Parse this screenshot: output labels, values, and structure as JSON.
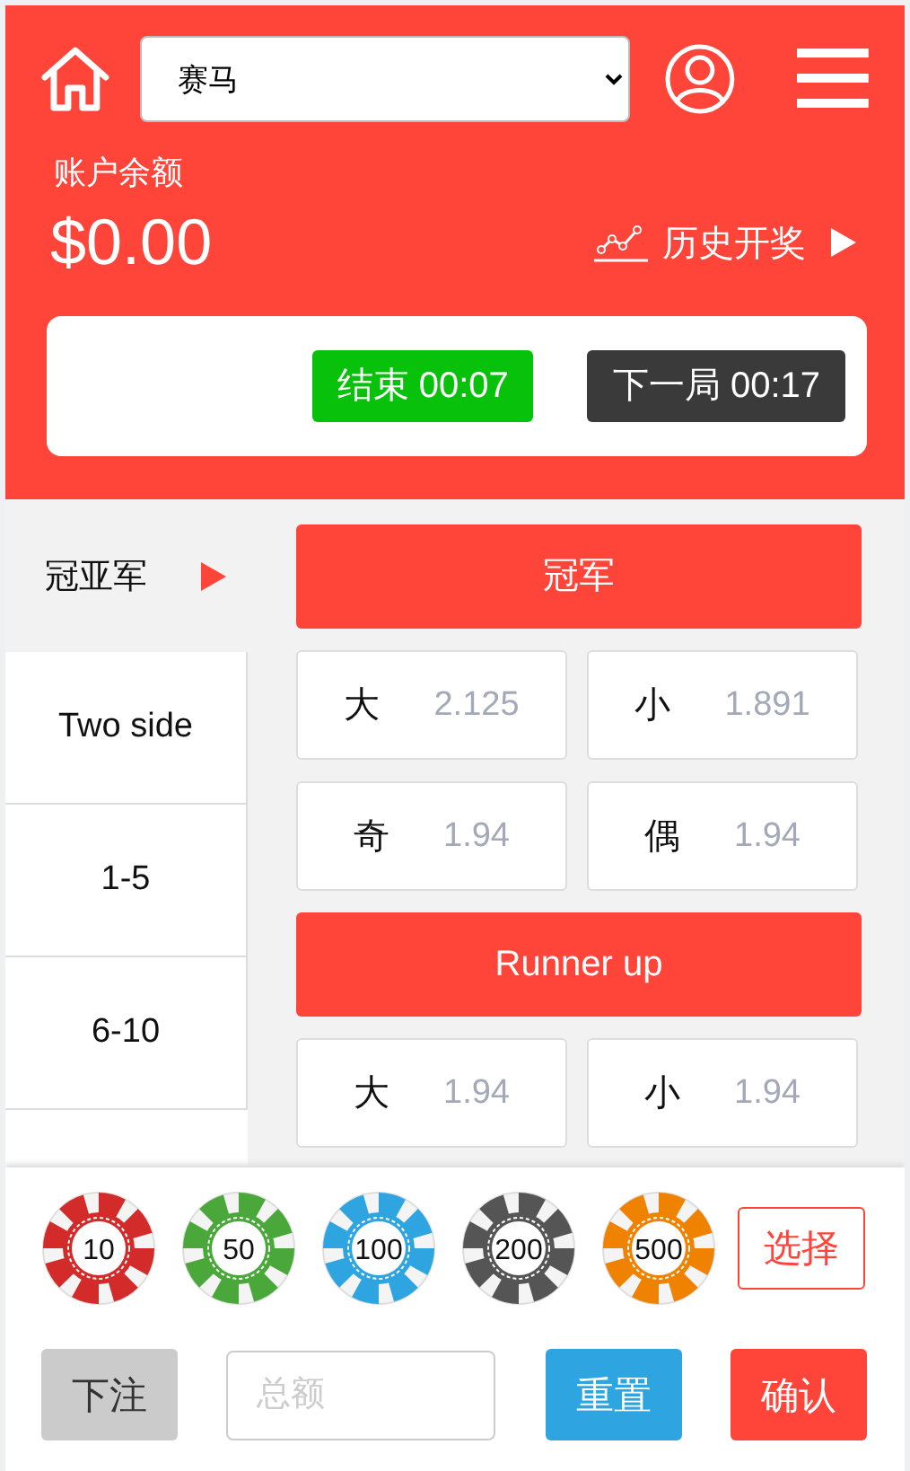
{
  "header": {
    "game_select": {
      "value": "赛马"
    }
  },
  "balance": {
    "label": "账户余额",
    "amount": "$0.00"
  },
  "history_link": {
    "label": "历史开奖"
  },
  "timers": {
    "closing": "结束 00:07",
    "next": "下一局 00:17"
  },
  "sidebar": {
    "items": [
      {
        "label": "冠亚军",
        "selected": true
      },
      {
        "label": "Two side",
        "selected": false
      },
      {
        "label": "1-5",
        "selected": false
      },
      {
        "label": "6-10",
        "selected": false
      }
    ]
  },
  "bet_groups": [
    {
      "title": "冠军",
      "bets": [
        {
          "label": "大",
          "odds": "2.125"
        },
        {
          "label": "小",
          "odds": "1.891"
        },
        {
          "label": "奇",
          "odds": "1.94"
        },
        {
          "label": "偶",
          "odds": "1.94"
        }
      ]
    },
    {
      "title": "Runner up",
      "bets": [
        {
          "label": "大",
          "odds": "1.94"
        },
        {
          "label": "小",
          "odds": "1.94"
        }
      ]
    }
  ],
  "chips": [
    {
      "value": "10",
      "color": "#d32a2a"
    },
    {
      "value": "50",
      "color": "#4aa83a"
    },
    {
      "value": "100",
      "color": "#2ea5e0"
    },
    {
      "value": "200",
      "color": "#555555"
    },
    {
      "value": "500",
      "color": "#ef8200"
    }
  ],
  "choose_button": "选择",
  "footer": {
    "bet_button": "下注",
    "total_field": {
      "placeholder": "总额"
    },
    "reset_button": "重置",
    "confirm_button": "确认"
  }
}
